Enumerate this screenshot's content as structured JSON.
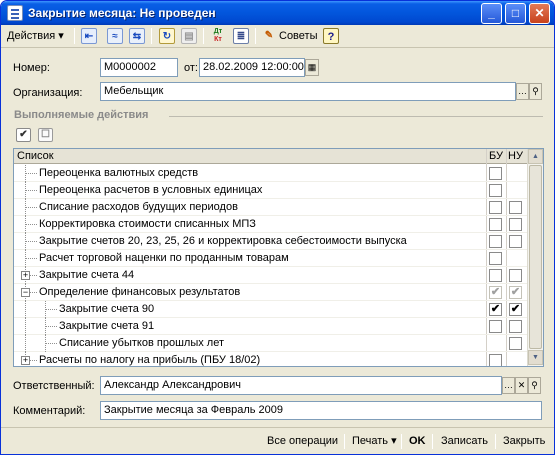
{
  "window": {
    "title": "Закрытие месяца: Не проведен",
    "btn_minimize": "_",
    "btn_maximize": "□",
    "btn_close": "✕"
  },
  "toolbar": {
    "actions_label": "Действия",
    "actions_arrow": "▾",
    "dt_label": "Дт",
    "kt_label": "Кт",
    "advice_label": "Советы",
    "help_label": "?"
  },
  "form": {
    "number_label": "Номер:",
    "number_value": "М0000002",
    "date_label": "от:",
    "date_value": "28.02.2009 12:00:00",
    "org_label": "Организация:",
    "org_value": "Мебельщик",
    "section_title": "Выполняемые действия",
    "responsible_label": "Ответственный:",
    "responsible_value": "Александр Александрович",
    "comment_label": "Комментарий:",
    "comment_value": "Закрытие месяца за Февраль 2009"
  },
  "grid": {
    "columns": {
      "list": "Список",
      "bu": "БУ",
      "nu": "НУ"
    },
    "rows": [
      {
        "label": "Переоценка валютных средств",
        "level": 0,
        "expander": "",
        "bu": "empty",
        "nu": "none"
      },
      {
        "label": "Переоценка расчетов в условных единицах",
        "level": 0,
        "expander": "",
        "bu": "empty",
        "nu": "none"
      },
      {
        "label": "Списание расходов будущих периодов",
        "level": 0,
        "expander": "",
        "bu": "empty",
        "nu": "empty"
      },
      {
        "label": "Корректировка стоимости списанных МПЗ",
        "level": 0,
        "expander": "",
        "bu": "empty",
        "nu": "empty"
      },
      {
        "label": "Закрытие счетов 20, 23, 25, 26 и корректировка себестоимости выпуска",
        "level": 0,
        "expander": "",
        "bu": "empty",
        "nu": "empty"
      },
      {
        "label": "Расчет торговой наценки по проданным товарам",
        "level": 0,
        "expander": "",
        "bu": "empty",
        "nu": "none"
      },
      {
        "label": "Закрытие счета 44",
        "level": 0,
        "expander": "+",
        "bu": "empty",
        "nu": "empty"
      },
      {
        "label": "Определение финансовых результатов",
        "level": 0,
        "expander": "−",
        "bu": "checked-disabled",
        "nu": "checked-disabled"
      },
      {
        "label": "Закрытие счета 90",
        "level": 1,
        "expander": "",
        "bu": "checked",
        "nu": "checked"
      },
      {
        "label": "Закрытие счета 91",
        "level": 1,
        "expander": "",
        "bu": "empty",
        "nu": "empty"
      },
      {
        "label": "Списание убытков прошлых лет",
        "level": 1,
        "expander": "",
        "bu": "none",
        "nu": "empty"
      },
      {
        "label": "Расчеты по налогу на прибыль (ПБУ 18/02)",
        "level": 0,
        "expander": "+",
        "bu": "empty",
        "nu": "none"
      }
    ]
  },
  "bottom": {
    "all_ops": "Все операции",
    "print": "Печать",
    "print_arrow": "▾",
    "ok": "OK",
    "save": "Записать",
    "close": "Закрыть"
  },
  "icons": {
    "checkmark": "✔",
    "expand_all": "check-all-icon",
    "collapse_all": "uncheck-all-icon"
  },
  "colors": {
    "titlebar": "#0256dc",
    "window_bg": "#ece9d8",
    "section_title": "#8a8a8a"
  }
}
